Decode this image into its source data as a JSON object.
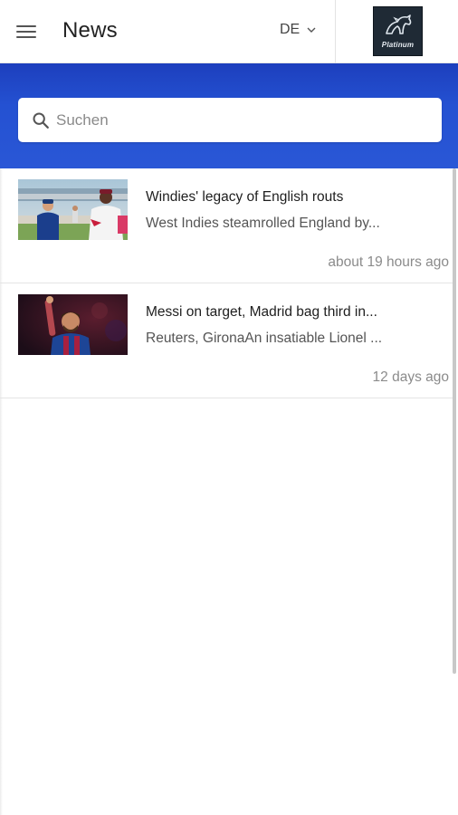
{
  "header": {
    "title": "News",
    "language": "DE",
    "logo_text": "Platinum"
  },
  "search": {
    "placeholder": "Suchen"
  },
  "articles": [
    {
      "title": "Windies' legacy of English routs",
      "summary": "West Indies steamrolled England by...",
      "time": "about 19 hours ago"
    },
    {
      "title": "Messi on target, Madrid bag third in...",
      "summary": "Reuters, GironaAn insatiable Lionel ...",
      "time": "12 days ago"
    }
  ],
  "colors": {
    "search_band": "#2451d2",
    "logo_background": "#1f2a35"
  }
}
